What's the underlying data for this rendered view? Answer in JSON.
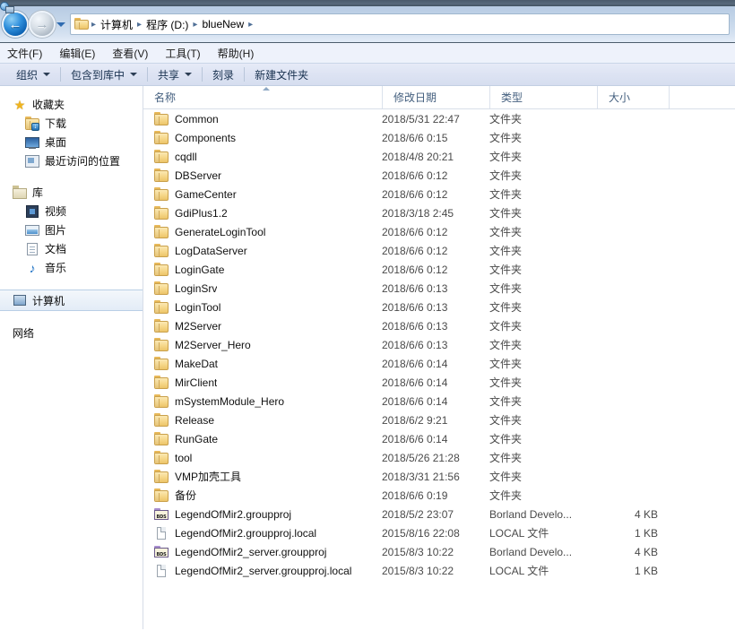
{
  "nav": {
    "back_icon": "back-arrow-icon",
    "forward_icon": "forward-arrow-icon",
    "history_icon": "history-dropdown-icon",
    "breadcrumbs": [
      "计算机",
      "程序 (D:)",
      "blueNew"
    ],
    "separator": "▸"
  },
  "menu": {
    "items": [
      {
        "label": "文件(F)",
        "name": "menu-file"
      },
      {
        "label": "编辑(E)",
        "name": "menu-edit"
      },
      {
        "label": "查看(V)",
        "name": "menu-view"
      },
      {
        "label": "工具(T)",
        "name": "menu-tools"
      },
      {
        "label": "帮助(H)",
        "name": "menu-help"
      }
    ]
  },
  "toolbar": {
    "organize": "组织",
    "include_library": "包含到库中",
    "share": "共享",
    "burn": "刻录",
    "new_folder": "新建文件夹"
  },
  "sidebar": {
    "favorites": {
      "label": "收藏夹",
      "icon": "star-icon"
    },
    "favorites_items": [
      {
        "label": "下载",
        "icon": "download-folder-icon"
      },
      {
        "label": "桌面",
        "icon": "desktop-icon"
      },
      {
        "label": "最近访问的位置",
        "icon": "recent-places-icon"
      }
    ],
    "library": {
      "label": "库",
      "icon": "library-icon"
    },
    "library_items": [
      {
        "label": "视频",
        "icon": "video-icon"
      },
      {
        "label": "图片",
        "icon": "pictures-icon"
      },
      {
        "label": "文档",
        "icon": "documents-icon"
      },
      {
        "label": "音乐",
        "icon": "music-icon"
      }
    ],
    "computer": {
      "label": "计算机",
      "icon": "computer-icon",
      "selected": true
    },
    "network": {
      "label": "网络",
      "icon": "network-icon"
    }
  },
  "columns": {
    "name": "名称",
    "date_modified": "修改日期",
    "type": "类型",
    "size": "大小",
    "sort_column": "名称",
    "sort_direction": "ascending"
  },
  "files": [
    {
      "name": "Common",
      "date": "2018/5/31 22:47",
      "type": "文件夹",
      "size": "",
      "icon": "folder-icon"
    },
    {
      "name": "Components",
      "date": "2018/6/6 0:15",
      "type": "文件夹",
      "size": "",
      "icon": "folder-icon"
    },
    {
      "name": "cqdll",
      "date": "2018/4/8 20:21",
      "type": "文件夹",
      "size": "",
      "icon": "folder-icon"
    },
    {
      "name": "DBServer",
      "date": "2018/6/6 0:12",
      "type": "文件夹",
      "size": "",
      "icon": "folder-icon"
    },
    {
      "name": "GameCenter",
      "date": "2018/6/6 0:12",
      "type": "文件夹",
      "size": "",
      "icon": "folder-icon"
    },
    {
      "name": "GdiPlus1.2",
      "date": "2018/3/18 2:45",
      "type": "文件夹",
      "size": "",
      "icon": "folder-icon"
    },
    {
      "name": "GenerateLoginTool",
      "date": "2018/6/6 0:12",
      "type": "文件夹",
      "size": "",
      "icon": "folder-icon"
    },
    {
      "name": "LogDataServer",
      "date": "2018/6/6 0:12",
      "type": "文件夹",
      "size": "",
      "icon": "folder-icon"
    },
    {
      "name": "LoginGate",
      "date": "2018/6/6 0:12",
      "type": "文件夹",
      "size": "",
      "icon": "folder-icon"
    },
    {
      "name": "LoginSrv",
      "date": "2018/6/6 0:13",
      "type": "文件夹",
      "size": "",
      "icon": "folder-icon"
    },
    {
      "name": "LoginTool",
      "date": "2018/6/6 0:13",
      "type": "文件夹",
      "size": "",
      "icon": "folder-icon"
    },
    {
      "name": "M2Server",
      "date": "2018/6/6 0:13",
      "type": "文件夹",
      "size": "",
      "icon": "folder-icon"
    },
    {
      "name": "M2Server_Hero",
      "date": "2018/6/6 0:13",
      "type": "文件夹",
      "size": "",
      "icon": "folder-icon"
    },
    {
      "name": "MakeDat",
      "date": "2018/6/6 0:14",
      "type": "文件夹",
      "size": "",
      "icon": "folder-icon"
    },
    {
      "name": "MirClient",
      "date": "2018/6/6 0:14",
      "type": "文件夹",
      "size": "",
      "icon": "folder-icon"
    },
    {
      "name": "mSystemModule_Hero",
      "date": "2018/6/6 0:14",
      "type": "文件夹",
      "size": "",
      "icon": "folder-icon"
    },
    {
      "name": "Release",
      "date": "2018/6/2 9:21",
      "type": "文件夹",
      "size": "",
      "icon": "folder-icon"
    },
    {
      "name": "RunGate",
      "date": "2018/6/6 0:14",
      "type": "文件夹",
      "size": "",
      "icon": "folder-icon"
    },
    {
      "name": "tool",
      "date": "2018/5/26 21:28",
      "type": "文件夹",
      "size": "",
      "icon": "folder-icon"
    },
    {
      "name": "VMP加壳工具",
      "date": "2018/3/31 21:56",
      "type": "文件夹",
      "size": "",
      "icon": "folder-icon"
    },
    {
      "name": "备份",
      "date": "2018/6/6 0:19",
      "type": "文件夹",
      "size": "",
      "icon": "folder-icon"
    },
    {
      "name": "LegendOfMir2.groupproj",
      "date": "2018/5/2 23:07",
      "type": "Borland Develo...",
      "size": "4 KB",
      "icon": "bds-project-icon"
    },
    {
      "name": "LegendOfMir2.groupproj.local",
      "date": "2015/8/16 22:08",
      "type": "LOCAL 文件",
      "size": "1 KB",
      "icon": "generic-file-icon"
    },
    {
      "name": "LegendOfMir2_server.groupproj",
      "date": "2015/8/3 10:22",
      "type": "Borland Develo...",
      "size": "4 KB",
      "icon": "bds-project-icon"
    },
    {
      "name": "LegendOfMir2_server.groupproj.local",
      "date": "2015/8/3 10:22",
      "type": "LOCAL 文件",
      "size": "1 KB",
      "icon": "generic-file-icon"
    }
  ],
  "colors": {
    "title_gradient_top": "#b7cbe3",
    "title_gradient_bottom": "#e3ecf7",
    "toolbar_bg": "#dde3f3",
    "header_text": "#45607f",
    "folder_yellow": "#f7d98c",
    "selection_border": "#b9cfe6"
  }
}
